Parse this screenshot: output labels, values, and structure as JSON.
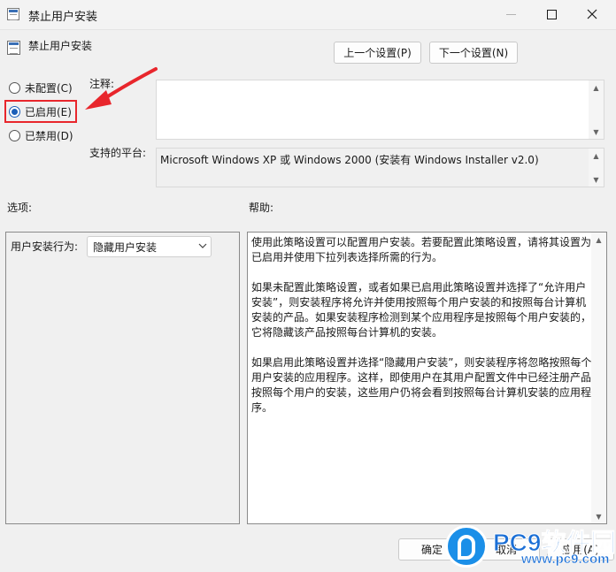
{
  "window": {
    "title": "禁止用户安装",
    "controls": [
      "minimize-icon",
      "maximize-icon",
      "close-icon"
    ]
  },
  "header": {
    "setting_name": "禁止用户安装",
    "prev_button": "上一个设置(P)",
    "next_button": "下一个设置(N)"
  },
  "state": {
    "options": [
      {
        "label": "未配置(C)",
        "selected": false
      },
      {
        "label": "已启用(E)",
        "selected": true
      },
      {
        "label": "已禁用(D)",
        "selected": false
      }
    ]
  },
  "comment": {
    "label": "注释:",
    "value": ""
  },
  "platform": {
    "label": "支持的平台:",
    "value": "Microsoft Windows XP 或 Windows 2000 (安装有 Windows Installer v2.0)"
  },
  "options_section": {
    "label": "选项:",
    "field_label": "用户安装行为:",
    "selected_value": "隐藏用户安装"
  },
  "help_section": {
    "label": "帮助:",
    "paragraphs": [
      "使用此策略设置可以配置用户安装。若要配置此策略设置，请将其设置为已启用并使用下拉列表选择所需的行为。",
      "如果未配置此策略设置，或者如果已启用此策略设置并选择了“允许用户安装”，则安装程序将允许并使用按照每个用户安装的和按照每台计算机安装的产品。如果安装程序检测到某个应用程序是按照每个用户安装的，它将隐藏该产品按照每台计算机的安装。",
      "如果启用此策略设置并选择“隐藏用户安装”，则安装程序将忽略按照每个用户安装的应用程序。这样，即使用户在其用户配置文件中已经注册产品按照每个用户的安装，这些用户仍将会看到按照每台计算机安装的应用程序。"
    ]
  },
  "footer": {
    "ok": "确定",
    "cancel": "取消",
    "apply": "应用(A)"
  },
  "watermark": {
    "brand": "PC9软件园",
    "url": "www.pc9.com"
  },
  "colors": {
    "accent": "#1b5fb8",
    "annotation_red": "#e8262c",
    "watermark_blue": "#1b6fd6"
  }
}
